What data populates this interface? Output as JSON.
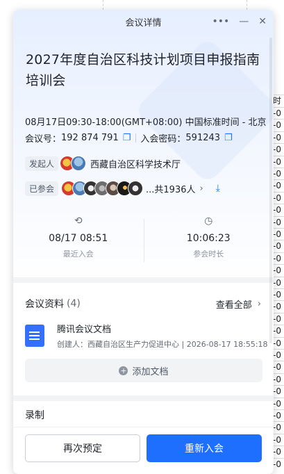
{
  "background_doc": {
    "header_char": "时",
    "cell_value": "-0",
    "cell_count": 30
  },
  "window": {
    "title": "会议详情",
    "more_label": "•••",
    "minimize_label": "—",
    "close_label": "✕"
  },
  "meeting": {
    "title": "2027年度自治区科技计划项目申报指南培训会",
    "time": "08月17日09:30-18:00(GMT+08:00) 中国标准时间 - 北京",
    "id_label": "会议号：",
    "id_value": "192 874 791",
    "password_label": "入会密码：",
    "password_value": "591243",
    "copy_icon": "❐"
  },
  "organizer": {
    "tag": "发起人",
    "name": "西藏自治区科学技术厅"
  },
  "participants": {
    "tag": "已参会",
    "count_text": "...共1936人",
    "chevron": "›",
    "download_icon": "⤓"
  },
  "stats": {
    "last_join": {
      "icon": "⟲",
      "value": "08/17 08:51",
      "label": "最近入会"
    },
    "duration": {
      "icon": "◷",
      "value": "10:06:23",
      "label": "参会时长"
    }
  },
  "materials": {
    "title": "会议资料",
    "count": "(4)",
    "view_all": "查看全部",
    "chevron": "›",
    "doc_name": "腾讯会议文档",
    "doc_meta": "创建人：西藏自治区生产力促进中心 | 2026-08-17 18:55:18",
    "add_label": "添加文档",
    "add_icon": "+"
  },
  "recording": {
    "title": "录制"
  },
  "footer": {
    "reschedule_label": "再次预定",
    "rejoin_label": "重新入会"
  },
  "colors": {
    "accent": "#1f6fff",
    "doc_icon": "#3370ff"
  }
}
